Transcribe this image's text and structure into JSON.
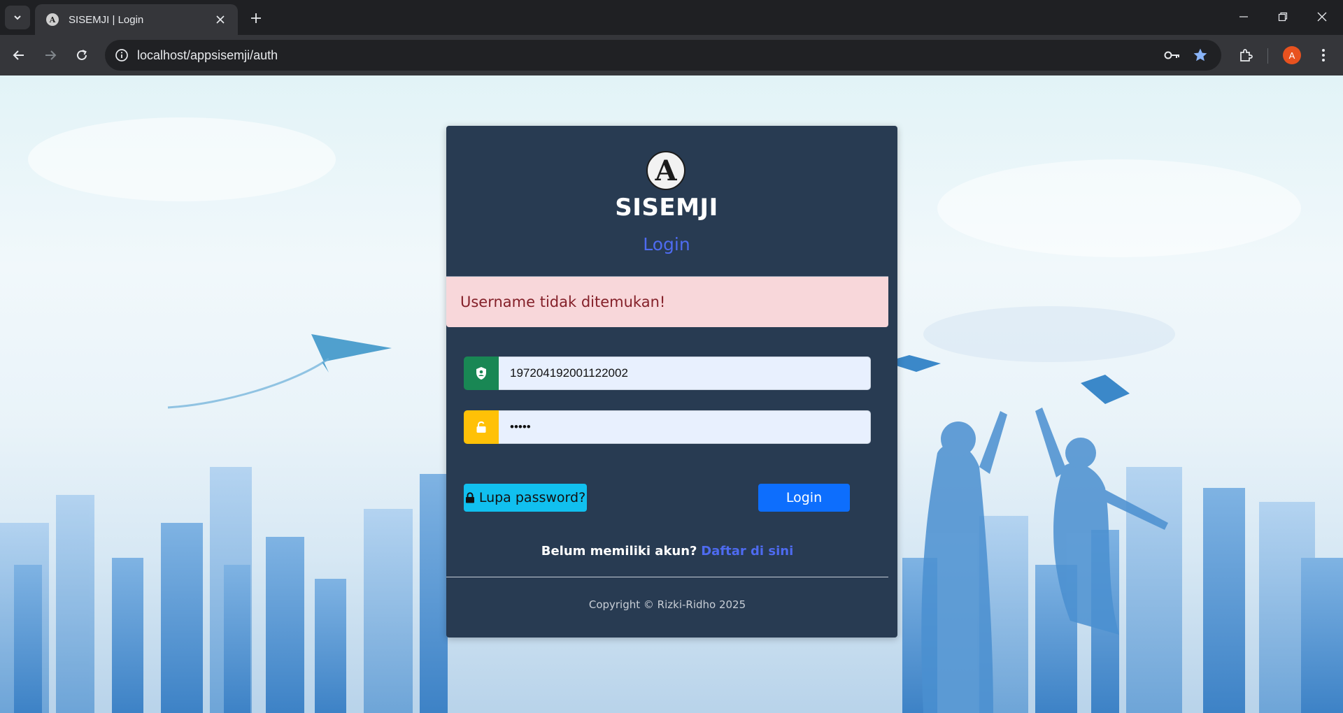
{
  "browser": {
    "tab_title": "SISEMJI | Login",
    "tab_favicon_letter": "A",
    "url": "localhost/appsisemji/auth",
    "profile_initial": "A"
  },
  "page": {
    "logo_letter": "A",
    "brand": "SISEMJI",
    "heading": "Login",
    "alert": "Username tidak ditemukan!",
    "username_value": "197204192001122002",
    "password_masked": "•••••",
    "forgot_label": "Lupa password?",
    "login_label": "Login",
    "register_question": "Belum memiliki akun?",
    "register_link": "Daftar di sini",
    "copyright": "Copyright © Rizki-Ridho 2025"
  },
  "colors": {
    "card_bg": "#283b52",
    "accent_link": "#4e6bf0",
    "alert_bg": "#f8d7da",
    "alert_text": "#842029",
    "username_icon_bg": "#198754",
    "password_icon_bg": "#ffc107",
    "forgot_btn_bg": "#11c0ef",
    "login_btn_bg": "#0d6efd"
  },
  "icons": {
    "username": "person-badge-icon",
    "password": "unlock-icon",
    "forgot": "lock-icon",
    "site_info": "info-icon",
    "password_manager": "key-icon",
    "bookmark": "star-icon",
    "extensions": "puzzle-icon",
    "menu": "kebab-menu-icon"
  }
}
